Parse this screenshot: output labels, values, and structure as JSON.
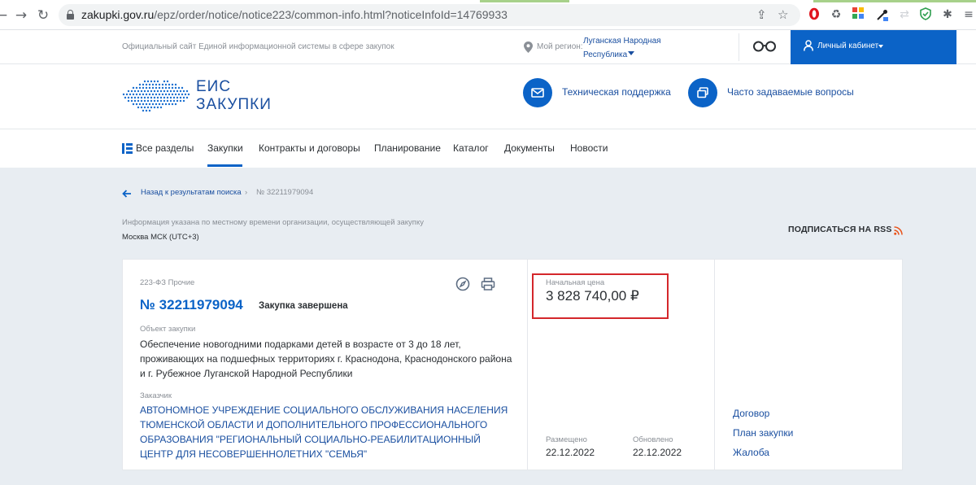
{
  "browser": {
    "url_domain": "zakupki.gov.ru",
    "url_path": "/epz/order/notice/notice223/common-info.html?noticeInfoId=14769933"
  },
  "header": {
    "site_caption": "Официальный сайт Единой информационной системы в сфере закупок",
    "region_label": "Мой регион:",
    "region_name": "Луганская Народная Республика",
    "cabinet_label": "Личный кабинет"
  },
  "logo": {
    "line1": "ЕИС",
    "line2": "ЗАКУПКИ"
  },
  "support": {
    "tech_support": "Техническая поддержка",
    "faq": "Часто задаваемые вопросы"
  },
  "nav": {
    "items": [
      "Все разделы",
      "Закупки",
      "Контракты и договоры",
      "Планирование",
      "Каталог",
      "Документы",
      "Новости"
    ],
    "active": "Закупки"
  },
  "breadcrumb": {
    "back": "Назад к результатам поиска",
    "separator": "›",
    "number": "№ 32211979094"
  },
  "timezone": {
    "note": "Информация указана по местному времени организации, осуществляющей закупку",
    "value": "Москва МСК (UTC+3)"
  },
  "rss": {
    "label": "ПОДПИСАТЬСЯ НА RSS"
  },
  "notice": {
    "law_type": "223-ФЗ Прочие",
    "number": "№ 32211979094",
    "status": "Закупка завершена",
    "object_label": "Объект закупки",
    "object_text": "Обеспечение новогодними подарками детей в возрасте от 3 до 18 лет, проживающих на подшефных территориях г. Краснодона, Краснодонского района и г. Рубежное Луганской Народной Республики",
    "customer_label": "Заказчик",
    "customer_text": "АВТОНОМНОЕ УЧРЕЖДЕНИЕ СОЦИАЛЬНОГО ОБСЛУЖИВАНИЯ НАСЕЛЕНИЯ ТЮМЕНСКОЙ ОБЛАСТИ И ДОПОЛНИТЕЛЬНОГО ПРОФЕССИОНАЛЬНОГО ОБРАЗОВАНИЯ \"РЕГИОНАЛЬНЫЙ СОЦИАЛЬНО-РЕАБИЛИТАЦИОННЫЙ ЦЕНТР ДЛЯ НЕСОВЕРШЕННОЛЕТНИХ \"СЕМЬЯ\"",
    "price_label": "Начальная цена",
    "price_value": "3 828 740,00 ₽",
    "posted_label": "Размещено",
    "posted_date": "22.12.2022",
    "updated_label": "Обновлено",
    "updated_date": "22.12.2022",
    "links": [
      "Договор",
      "План закупки",
      "Жалоба"
    ]
  },
  "colors": {
    "brand_blue": "#0b63c7",
    "link_blue": "#1a4fa0",
    "highlight_red": "#d4272b",
    "page_bg": "#e8edf2"
  }
}
